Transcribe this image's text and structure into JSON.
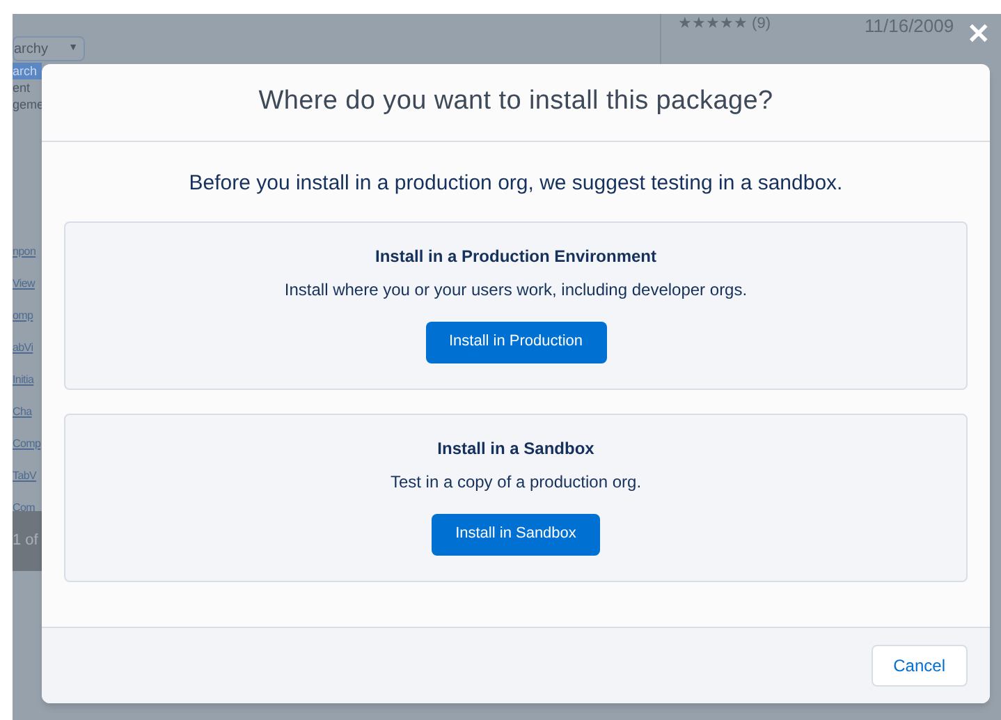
{
  "background": {
    "dropdown": {
      "value": "archy",
      "caret": "▼"
    },
    "left_items": [
      {
        "label": "arch",
        "selected": true
      },
      {
        "label": "ent",
        "selected": false
      },
      {
        "label": "geme",
        "selected": false
      }
    ],
    "left_links": [
      "npon",
      "View",
      "omp",
      "abVi",
      "Initia",
      "Cha",
      "Comp",
      "TabV",
      "Com"
    ],
    "pager": "1 of",
    "rating": "★★★★★ (9)",
    "date": "11/16/2009"
  },
  "close": "✕",
  "modal": {
    "title": "Where do you want to install this package?",
    "intro": "Before you install in a production org, we suggest testing in a sandbox.",
    "options": [
      {
        "heading": "Install in a Production Environment",
        "description": "Install where you or your users work, including developer orgs.",
        "button": "Install in Production"
      },
      {
        "heading": "Install in a Sandbox",
        "description": "Test in a copy of a production org.",
        "button": "Install in Sandbox"
      }
    ],
    "footer_buttons": [
      "Cancel"
    ]
  }
}
